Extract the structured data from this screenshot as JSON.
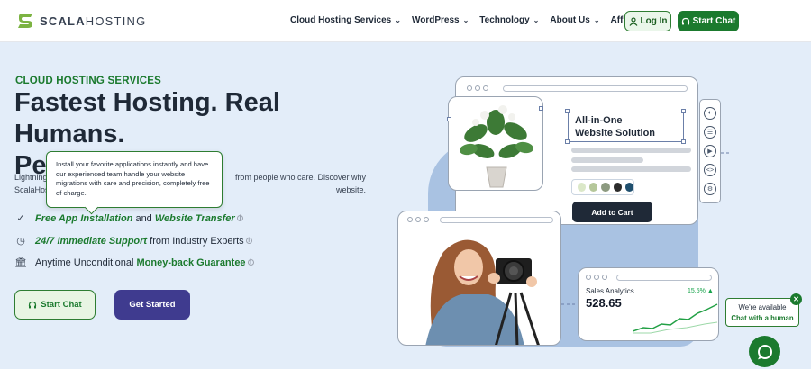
{
  "brand": {
    "name_bold": "SCALA",
    "name_thin": "HOSTING"
  },
  "nav": [
    {
      "label": "Cloud Hosting Services"
    },
    {
      "label": "WordPress"
    },
    {
      "label": "Technology"
    },
    {
      "label": "About Us"
    },
    {
      "label": "Affiliates"
    }
  ],
  "header": {
    "login_label": "Log In",
    "chat_label": "Start Chat"
  },
  "hero": {
    "eyebrow": "CLOUD HOSTING SERVICES",
    "title_line1": "Fastest Hosting. Real Humans.",
    "title_line2": "Perfect Score.",
    "desc_line1_left": "Lightning",
    "desc_line1_right": "from people who care. Discover why",
    "desc_line2_left": "ScalaHos",
    "desc_line2_right": "website.",
    "tooltip": "Install your favorite applications instantly and have our experienced team handle your website migrations with care and precision, completely free of charge.",
    "features": [
      {
        "a": "Free App Installation",
        "b": " and ",
        "c": "Website Transfer"
      },
      {
        "a": "24/7 Immediate Support",
        "b": " from Industry Experts"
      },
      {
        "a": "Anytime Unconditional ",
        "b": "Money-back Guarantee"
      }
    ],
    "start_chat_label": "Start Chat",
    "get_started_label": "Get Started"
  },
  "illustration": {
    "card_title_line1": "All-in-One",
    "card_title_line2": "Website Solution",
    "add_to_cart": "Add to Cart",
    "swatch_colors": [
      "#dbe8c8",
      "#b5c79a",
      "#8c9a80",
      "#2b2b2b",
      "#1f4f6e"
    ],
    "sales_title": "Sales Analytics",
    "sales_value": "528.65",
    "sales_change": "15.5%"
  },
  "chat_widget": {
    "line1": "We're available",
    "line2": "Chat with a human",
    "close_icon": "close-icon",
    "bubble_icon": "chat-bubble-icon"
  },
  "colors": {
    "brand_green": "#1b7a2e",
    "accent_purple": "#3f3b8f",
    "hero_bg": "#e3edf9"
  }
}
